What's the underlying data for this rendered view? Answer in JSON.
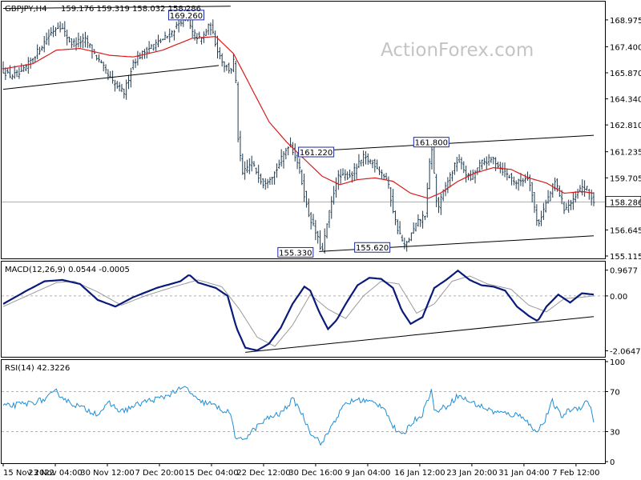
{
  "chart_data": {
    "type": "candlestick",
    "symbol_header": "GBPJPY,H4",
    "ohlc_header": "159.176 159.319 158.032 158.286",
    "watermark": "ActionForex.com",
    "current_price": "158.286",
    "colors": {
      "bars": "#1f3a4f",
      "ma": "#d91b1b",
      "macd": "#0a1a7a",
      "signal": "#9a9a9a",
      "rsi": "#1e8fd6",
      "grid": "#b0b0b0"
    },
    "price_axis": {
      "range": [
        155.115,
        169.91
      ],
      "ticks": [
        "168.975",
        "167.400",
        "165.870",
        "164.340",
        "162.810",
        "161.235",
        "159.705",
        "158.175",
        "156.645",
        "155.115"
      ],
      "tick_values": [
        168.975,
        167.4,
        165.87,
        164.34,
        162.81,
        161.235,
        159.705,
        158.175,
        156.645,
        155.115
      ]
    },
    "x_labels": [
      "15 Nov 2022",
      "23 Nov 04:00",
      "30 Nov 12:00",
      "7 Dec 20:00",
      "15 Dec 04:00",
      "22 Dec 12:00",
      "30 Dec 16:00",
      "9 Jan 04:00",
      "16 Jan 12:00",
      "23 Jan 20:00",
      "31 Jan 04:00",
      "7 Feb 12:00"
    ],
    "annotations": [
      {
        "text": "169.260",
        "t": 0.31,
        "y": 169.26
      },
      {
        "text": "161.220",
        "t": 0.53,
        "y": 161.22
      },
      {
        "text": "161.800",
        "t": 0.725,
        "y": 161.8
      },
      {
        "text": "155.330",
        "t": 0.495,
        "y": 155.33
      },
      {
        "text": "155.620",
        "t": 0.625,
        "y": 155.62
      }
    ],
    "trendlines": [
      {
        "t1": 0.0,
        "y1": 169.65,
        "t2": 0.385,
        "y2": 169.78
      },
      {
        "t1": 0.0,
        "y1": 164.9,
        "t2": 0.365,
        "y2": 166.3
      },
      {
        "t1": 0.535,
        "y1": 161.3,
        "t2": 1.0,
        "y2": 162.2
      },
      {
        "t1": 0.535,
        "y1": 155.38,
        "t2": 1.0,
        "y2": 156.3
      }
    ],
    "anchors": [
      [
        0.0,
        166.0
      ],
      [
        0.01,
        165.7
      ],
      [
        0.03,
        165.8
      ],
      [
        0.06,
        167.2
      ],
      [
        0.08,
        168.2
      ],
      [
        0.095,
        168.7
      ],
      [
        0.115,
        167.6
      ],
      [
        0.14,
        167.8
      ],
      [
        0.165,
        166.4
      ],
      [
        0.185,
        165.3
      ],
      [
        0.205,
        164.7
      ],
      [
        0.22,
        166.5
      ],
      [
        0.245,
        167.3
      ],
      [
        0.265,
        167.7
      ],
      [
        0.285,
        168.2
      ],
      [
        0.3,
        168.9
      ],
      [
        0.31,
        169.26
      ],
      [
        0.32,
        168.2
      ],
      [
        0.335,
        167.8
      ],
      [
        0.35,
        168.7
      ],
      [
        0.365,
        167.0
      ],
      [
        0.375,
        166.3
      ],
      [
        0.385,
        166.0
      ],
      [
        0.392,
        166.8
      ],
      [
        0.398,
        161.8
      ],
      [
        0.405,
        159.9
      ],
      [
        0.42,
        160.6
      ],
      [
        0.44,
        159.4
      ],
      [
        0.46,
        160.0
      ],
      [
        0.485,
        161.8
      ],
      [
        0.5,
        160.5
      ],
      [
        0.515,
        157.8
      ],
      [
        0.53,
        156.4
      ],
      [
        0.54,
        155.33
      ],
      [
        0.55,
        157.3
      ],
      [
        0.565,
        159.7
      ],
      [
        0.59,
        159.9
      ],
      [
        0.61,
        160.9
      ],
      [
        0.63,
        160.5
      ],
      [
        0.65,
        159.6
      ],
      [
        0.665,
        157.0
      ],
      [
        0.68,
        155.62
      ],
      [
        0.7,
        157.0
      ],
      [
        0.715,
        157.6
      ],
      [
        0.725,
        161.8
      ],
      [
        0.735,
        157.8
      ],
      [
        0.75,
        159.3
      ],
      [
        0.77,
        160.8
      ],
      [
        0.79,
        159.6
      ],
      [
        0.81,
        160.6
      ],
      [
        0.83,
        160.8
      ],
      [
        0.85,
        160.0
      ],
      [
        0.87,
        159.4
      ],
      [
        0.89,
        159.8
      ],
      [
        0.905,
        156.9
      ],
      [
        0.92,
        158.3
      ],
      [
        0.935,
        159.5
      ],
      [
        0.95,
        157.9
      ],
      [
        0.965,
        158.3
      ],
      [
        0.98,
        159.2
      ],
      [
        0.99,
        159.0
      ],
      [
        1.0,
        158.286
      ]
    ],
    "ma_anchors": [
      [
        0.0,
        166.1
      ],
      [
        0.05,
        166.4
      ],
      [
        0.09,
        167.2
      ],
      [
        0.13,
        167.3
      ],
      [
        0.18,
        166.9
      ],
      [
        0.22,
        166.8
      ],
      [
        0.27,
        167.2
      ],
      [
        0.32,
        167.9
      ],
      [
        0.36,
        168.0
      ],
      [
        0.39,
        167.0
      ],
      [
        0.42,
        165.0
      ],
      [
        0.45,
        163.0
      ],
      [
        0.48,
        161.8
      ],
      [
        0.51,
        160.8
      ],
      [
        0.54,
        159.8
      ],
      [
        0.57,
        159.3
      ],
      [
        0.6,
        159.6
      ],
      [
        0.63,
        159.7
      ],
      [
        0.66,
        159.5
      ],
      [
        0.69,
        158.8
      ],
      [
        0.72,
        158.5
      ],
      [
        0.74,
        158.8
      ],
      [
        0.77,
        159.5
      ],
      [
        0.8,
        160.0
      ],
      [
        0.83,
        160.3
      ],
      [
        0.86,
        160.2
      ],
      [
        0.89,
        159.7
      ],
      [
        0.92,
        159.4
      ],
      [
        0.95,
        158.8
      ],
      [
        0.98,
        158.9
      ],
      [
        1.0,
        158.8
      ]
    ],
    "macd": {
      "label": "MACD(12,26,9) 0.0544 -0.0005",
      "range": [
        -2.2,
        1.2
      ],
      "ticks": [
        "0.9677",
        "0.00",
        "-2.0647"
      ],
      "tick_values": [
        0.9677,
        0.0,
        -2.0647
      ],
      "trendline": {
        "t1": 0.41,
        "y1": -2.12,
        "t2": 1.0,
        "y2": -0.78
      },
      "anchors": [
        [
          0.0,
          -0.3
        ],
        [
          0.04,
          0.2
        ],
        [
          0.07,
          0.55
        ],
        [
          0.1,
          0.6
        ],
        [
          0.13,
          0.45
        ],
        [
          0.16,
          -0.15
        ],
        [
          0.19,
          -0.4
        ],
        [
          0.22,
          -0.05
        ],
        [
          0.26,
          0.3
        ],
        [
          0.3,
          0.55
        ],
        [
          0.315,
          0.8
        ],
        [
          0.33,
          0.5
        ],
        [
          0.36,
          0.3
        ],
        [
          0.38,
          0.0
        ],
        [
          0.395,
          -1.2
        ],
        [
          0.41,
          -1.95
        ],
        [
          0.43,
          -2.05
        ],
        [
          0.45,
          -1.8
        ],
        [
          0.47,
          -1.2
        ],
        [
          0.49,
          -0.3
        ],
        [
          0.51,
          0.35
        ],
        [
          0.52,
          0.2
        ],
        [
          0.535,
          -0.6
        ],
        [
          0.55,
          -1.25
        ],
        [
          0.565,
          -0.9
        ],
        [
          0.58,
          -0.3
        ],
        [
          0.6,
          0.4
        ],
        [
          0.62,
          0.68
        ],
        [
          0.64,
          0.64
        ],
        [
          0.66,
          0.3
        ],
        [
          0.675,
          -0.55
        ],
        [
          0.69,
          -1.05
        ],
        [
          0.71,
          -0.8
        ],
        [
          0.73,
          0.3
        ],
        [
          0.75,
          0.6
        ],
        [
          0.77,
          0.95
        ],
        [
          0.79,
          0.6
        ],
        [
          0.81,
          0.4
        ],
        [
          0.83,
          0.35
        ],
        [
          0.85,
          0.2
        ],
        [
          0.87,
          -0.4
        ],
        [
          0.89,
          -0.75
        ],
        [
          0.905,
          -0.95
        ],
        [
          0.92,
          -0.4
        ],
        [
          0.94,
          0.05
        ],
        [
          0.96,
          -0.25
        ],
        [
          0.98,
          0.1
        ],
        [
          1.0,
          0.05
        ]
      ],
      "signal_anchors": [
        [
          0.0,
          -0.4
        ],
        [
          0.05,
          0.1
        ],
        [
          0.09,
          0.5
        ],
        [
          0.12,
          0.55
        ],
        [
          0.16,
          0.15
        ],
        [
          0.2,
          -0.35
        ],
        [
          0.24,
          0.0
        ],
        [
          0.29,
          0.35
        ],
        [
          0.33,
          0.6
        ],
        [
          0.37,
          0.35
        ],
        [
          0.4,
          -0.5
        ],
        [
          0.43,
          -1.55
        ],
        [
          0.46,
          -1.9
        ],
        [
          0.49,
          -1.1
        ],
        [
          0.52,
          0.05
        ],
        [
          0.55,
          -0.5
        ],
        [
          0.58,
          -0.85
        ],
        [
          0.61,
          0.0
        ],
        [
          0.64,
          0.55
        ],
        [
          0.67,
          0.45
        ],
        [
          0.7,
          -0.65
        ],
        [
          0.73,
          -0.3
        ],
        [
          0.76,
          0.55
        ],
        [
          0.79,
          0.75
        ],
        [
          0.82,
          0.45
        ],
        [
          0.86,
          0.25
        ],
        [
          0.89,
          -0.35
        ],
        [
          0.92,
          -0.6
        ],
        [
          0.95,
          -0.1
        ],
        [
          0.98,
          -0.05
        ],
        [
          1.0,
          0.0
        ]
      ]
    },
    "rsi": {
      "label": "RSI(14) 42.3226",
      "range": [
        0,
        100
      ],
      "ticks": [
        "100",
        "70",
        "30",
        "0"
      ],
      "tick_values": [
        100,
        70,
        30,
        0
      ],
      "anchors": [
        [
          0.0,
          55
        ],
        [
          0.04,
          58
        ],
        [
          0.07,
          62
        ],
        [
          0.09,
          70
        ],
        [
          0.11,
          60
        ],
        [
          0.14,
          52
        ],
        [
          0.16,
          48
        ],
        [
          0.18,
          58
        ],
        [
          0.2,
          50
        ],
        [
          0.22,
          55
        ],
        [
          0.24,
          60
        ],
        [
          0.27,
          64
        ],
        [
          0.29,
          70
        ],
        [
          0.31,
          74
        ],
        [
          0.33,
          60
        ],
        [
          0.35,
          58
        ],
        [
          0.37,
          52
        ],
        [
          0.385,
          48
        ],
        [
          0.395,
          20
        ],
        [
          0.41,
          24
        ],
        [
          0.43,
          35
        ],
        [
          0.45,
          44
        ],
        [
          0.47,
          48
        ],
        [
          0.49,
          62
        ],
        [
          0.5,
          55
        ],
        [
          0.52,
          30
        ],
        [
          0.54,
          18
        ],
        [
          0.56,
          40
        ],
        [
          0.58,
          58
        ],
        [
          0.6,
          62
        ],
        [
          0.62,
          60
        ],
        [
          0.645,
          55
        ],
        [
          0.66,
          35
        ],
        [
          0.675,
          25
        ],
        [
          0.69,
          38
        ],
        [
          0.71,
          48
        ],
        [
          0.725,
          72
        ],
        [
          0.73,
          50
        ],
        [
          0.75,
          55
        ],
        [
          0.77,
          66
        ],
        [
          0.79,
          60
        ],
        [
          0.81,
          55
        ],
        [
          0.83,
          50
        ],
        [
          0.86,
          47
        ],
        [
          0.88,
          46
        ],
        [
          0.9,
          30
        ],
        [
          0.915,
          38
        ],
        [
          0.93,
          60
        ],
        [
          0.945,
          45
        ],
        [
          0.96,
          52
        ],
        [
          0.98,
          55
        ],
        [
          0.99,
          62
        ],
        [
          1.0,
          42
        ]
      ]
    }
  }
}
